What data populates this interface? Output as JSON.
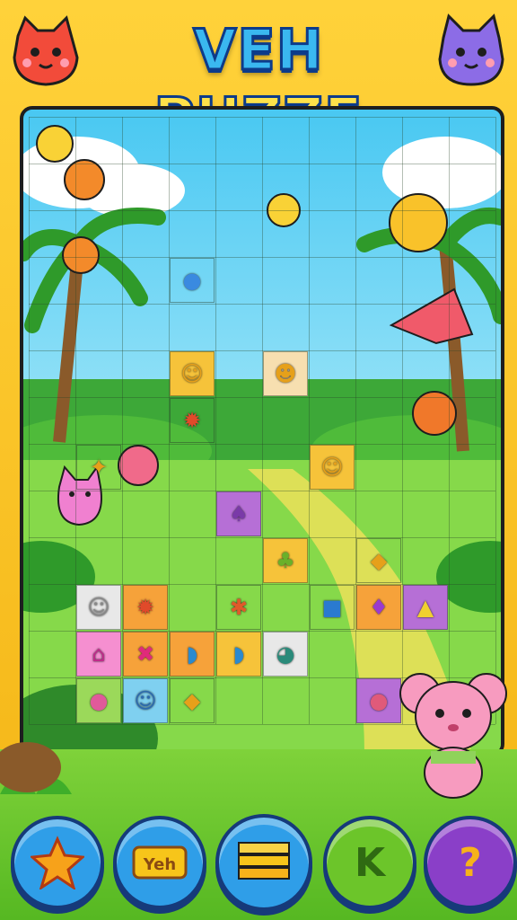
{
  "game": {
    "title_part1": "VEH",
    "title_part2": "PUZZE"
  },
  "buttons": [
    {
      "name": "star-button",
      "icon": "star-icon",
      "color": "#2f9ee8"
    },
    {
      "name": "ticket-button",
      "icon": "ticket-icon",
      "glyph": "Yeh",
      "color": "#2f9ee8"
    },
    {
      "name": "stack-button",
      "icon": "stack-icon",
      "color": "#2f9ee8"
    },
    {
      "name": "puzzle-button",
      "icon": "puzzle-icon",
      "glyph": "K",
      "color": "#6cc52a"
    },
    {
      "name": "hint-button",
      "icon": "question-icon",
      "glyph": "?",
      "color": "#8a3fc8"
    }
  ],
  "colors": {
    "frame": "#f9c21a",
    "sky": "#49c8f2",
    "grass": "#7dd94a",
    "outline": "#163a7a",
    "path": "#f2e15a"
  },
  "tiles": [
    {
      "name": "tile-blue-beetle",
      "icon": "beetle-icon",
      "bg": "none"
    },
    {
      "name": "tile-yellow-cat",
      "icon": "cat-face-icon",
      "bg": "#f6c33a"
    },
    {
      "name": "tile-yellow-chick",
      "icon": "chick-icon",
      "bg": "#f7dfb0"
    },
    {
      "name": "tile-red-crab",
      "icon": "crab-icon",
      "bg": "none"
    },
    {
      "name": "tile-yellow-fox",
      "icon": "fox-face-icon",
      "bg": "none"
    },
    {
      "name": "tile-yellow-face",
      "icon": "smiley-icon",
      "bg": "#f6c33a"
    },
    {
      "name": "tile-purple-monster",
      "icon": "monster-icon",
      "bg": "#b66fd6"
    },
    {
      "name": "tile-green-cup",
      "icon": "cupcake-icon",
      "bg": "#f6c33a"
    },
    {
      "name": "tile-yellow-bird",
      "icon": "bird-icon",
      "bg": "none"
    },
    {
      "name": "tile-white-cat",
      "icon": "white-cat-icon",
      "bg": "#e8e8e8"
    },
    {
      "name": "tile-orange-crab",
      "icon": "crab-icon",
      "bg": "#f6a23a"
    },
    {
      "name": "tile-orange-bug",
      "icon": "bug-icon",
      "bg": "none"
    },
    {
      "name": "tile-blue-car",
      "icon": "car-icon",
      "bg": "none"
    },
    {
      "name": "tile-purple-gem",
      "icon": "gem-icon",
      "bg": "#f6a23a"
    },
    {
      "name": "tile-purple-horn",
      "icon": "horn-icon",
      "bg": "#b66fd6"
    },
    {
      "name": "tile-pink-letter",
      "icon": "letter-a-icon",
      "bg": "#f58fd0"
    },
    {
      "name": "tile-pink-x",
      "icon": "x-icon",
      "bg": "#f6a23a"
    },
    {
      "name": "tile-yellow-fish",
      "icon": "fish-icon",
      "bg": "#f6a23a"
    },
    {
      "name": "tile-blue-fish",
      "icon": "fish-icon",
      "bg": "#f6c33a"
    },
    {
      "name": "tile-white-bird",
      "icon": "white-bird-icon",
      "bg": "#e8e8e8"
    },
    {
      "name": "tile-pink-pig",
      "icon": "pig-icon",
      "bg": "#9bd95a"
    },
    {
      "name": "tile-blue-bunny",
      "icon": "bunny-icon",
      "bg": "#7fd0f0"
    },
    {
      "name": "tile-teal-bird",
      "icon": "bird-icon",
      "bg": "none"
    },
    {
      "name": "tile-pink-blob",
      "icon": "blob-icon",
      "bg": "#b66fd6"
    }
  ]
}
